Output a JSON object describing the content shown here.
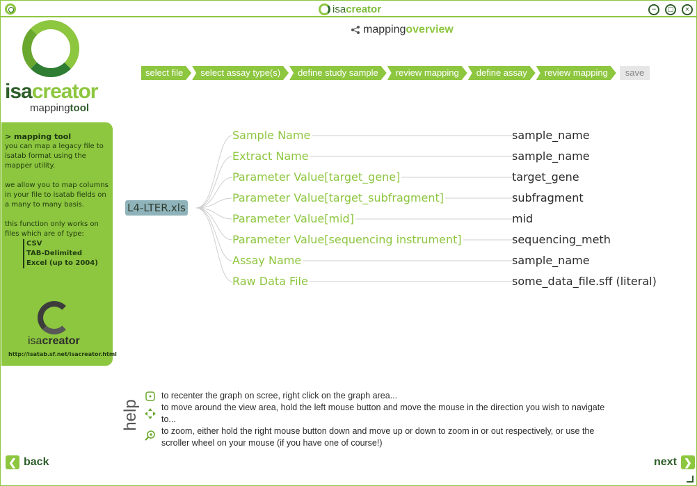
{
  "window": {
    "title_isa": "isa",
    "title_creator": "creator",
    "controls": {
      "minimize": "−",
      "maximize": "□",
      "close": "×"
    }
  },
  "logo": {
    "isa": "isa",
    "creator": "creator",
    "sub_mapping": "mapping",
    "sub_tool": "tool"
  },
  "sidebar": {
    "heading": "> mapping tool",
    "para1": "you can map a legacy file to isatab format using the mapper utility.",
    "para2": "we allow you to map columns in your file to isatab fields on a many to many basis.",
    "para3": "this function only works on files which are of type:",
    "file_types": [
      "CSV",
      "TAB-Delimited",
      "Excel (up to 2004)"
    ],
    "brand_isa": "isa",
    "brand_creator": "creator",
    "url": "http://isatab.sf.net/isacreator.html"
  },
  "header": {
    "icon": "share-icon",
    "part1": "mapping",
    "part2": "overview"
  },
  "steps": [
    {
      "label": "select file",
      "active": true
    },
    {
      "label": "select assay type(s)",
      "active": true
    },
    {
      "label": "define study sample",
      "active": true
    },
    {
      "label": "review mapping",
      "active": true
    },
    {
      "label": "define assay",
      "active": true
    },
    {
      "label": "review mapping",
      "active": true
    },
    {
      "label": "save",
      "active": false
    }
  ],
  "graph": {
    "source_file": "L4-LTER.xls",
    "mappings": [
      {
        "field": "Sample Name",
        "target": "sample_name"
      },
      {
        "field": "Extract Name",
        "target": "sample_name"
      },
      {
        "field": "Parameter Value[target_gene]",
        "target": "target_gene"
      },
      {
        "field": "Parameter Value[target_subfragment]",
        "target": "subfragment"
      },
      {
        "field": "Parameter Value[mid]",
        "target": "mid"
      },
      {
        "field": "Parameter Value[sequencing instrument]",
        "target": "sequencing_meth"
      },
      {
        "field": "Assay Name",
        "target": "sample_name"
      },
      {
        "field": "Raw Data File",
        "target": "some_data_file.sff (literal)"
      }
    ]
  },
  "help": {
    "label": "help",
    "items": [
      {
        "icon": "recenter-icon",
        "text": "to recenter the graph on scree, right click on the graph area..."
      },
      {
        "icon": "move-icon",
        "text": "to move around the view area, hold the left mouse button and move the mouse in the direction you wish to navigate to..."
      },
      {
        "icon": "zoom-icon",
        "text": "to zoom, either hold the right mouse button down and move up or down to zoom in or out respectively, or use the scroller wheel on your mouse (if you have one of course!)"
      }
    ]
  },
  "nav": {
    "back": "back",
    "next": "next"
  },
  "colors": {
    "accent": "#8dc63f",
    "dark_green": "#2e5e2a",
    "node_bg": "#8fb3ba"
  }
}
